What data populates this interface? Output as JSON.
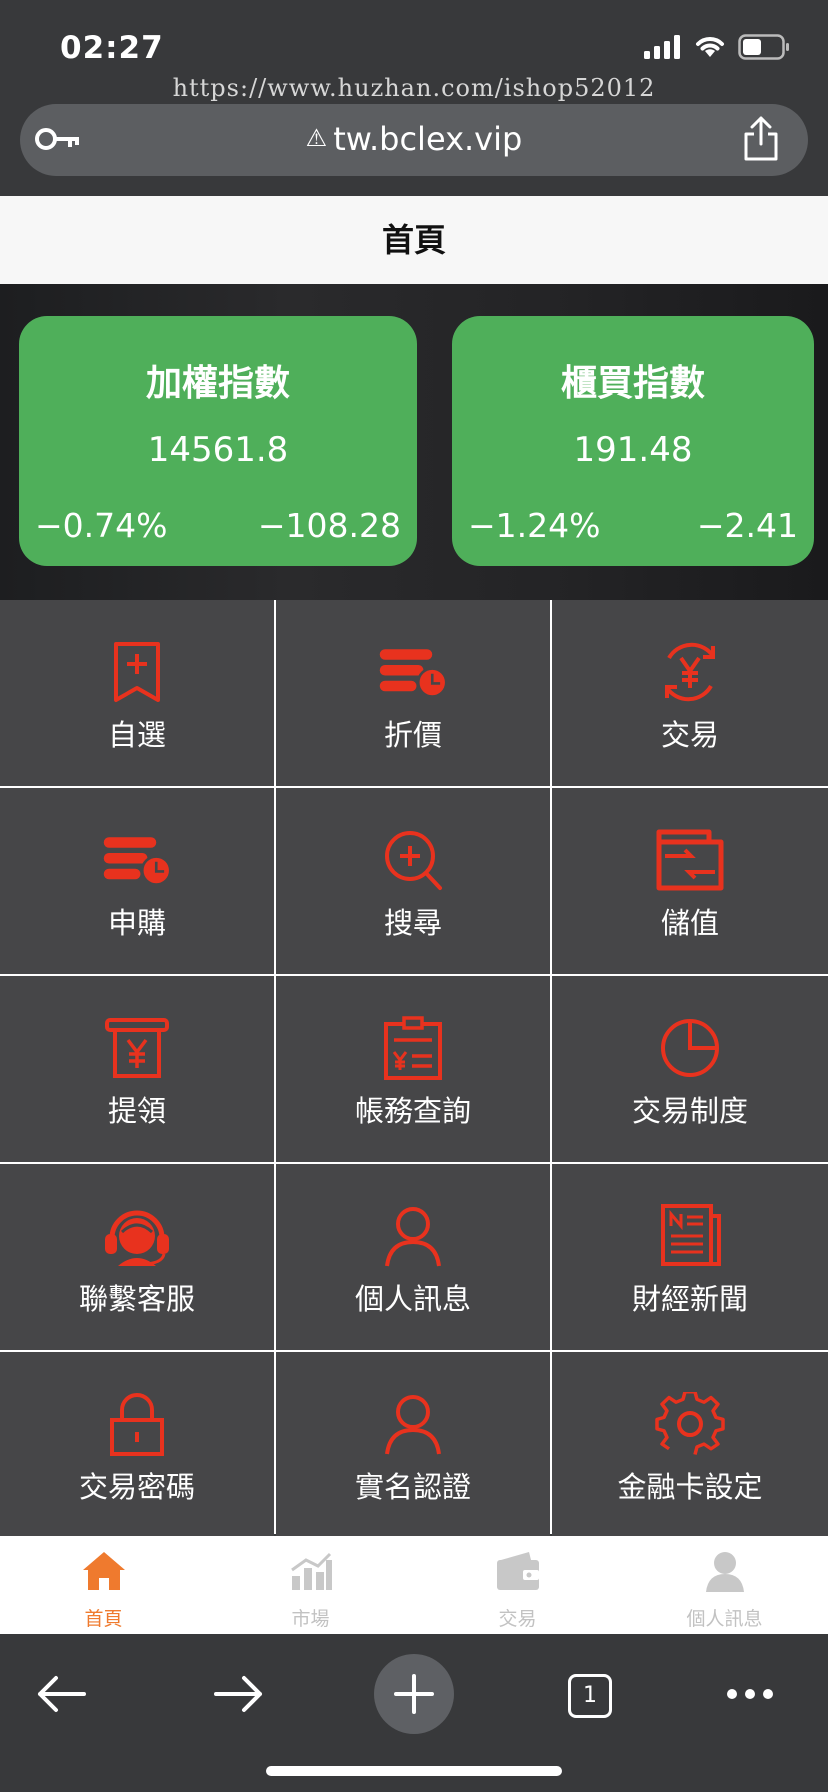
{
  "status_bar": {
    "time": "02:27"
  },
  "browser": {
    "watermark": "https://www.huzhan.com/ishop52012",
    "url": "tw.bclex.vip",
    "warning_glyph": "⚠",
    "open_tabs": "1"
  },
  "header": {
    "title": "首頁"
  },
  "indices": [
    {
      "name": "加權指數",
      "value": "14561.8",
      "change_pct": "−0.74%",
      "change": "−108.28"
    },
    {
      "name": "櫃買指數",
      "value": "191.48",
      "change_pct": "−1.24%",
      "change": "−2.41"
    }
  ],
  "grid": {
    "items": [
      {
        "label": "自選",
        "icon": "bookmark-plus-icon"
      },
      {
        "label": "折價",
        "icon": "discount-clock-icon"
      },
      {
        "label": "交易",
        "icon": "yen-cycle-icon"
      },
      {
        "label": "申購",
        "icon": "subscribe-clock-icon"
      },
      {
        "label": "搜尋",
        "icon": "search-plus-icon"
      },
      {
        "label": "儲值",
        "icon": "wallet-transfer-icon"
      },
      {
        "label": "提領",
        "icon": "atm-withdraw-icon"
      },
      {
        "label": "帳務查詢",
        "icon": "clipboard-ledger-icon"
      },
      {
        "label": "交易制度",
        "icon": "pie-chart-icon"
      },
      {
        "label": "聯繫客服",
        "icon": "customer-service-icon"
      },
      {
        "label": "個人訊息",
        "icon": "user-icon"
      },
      {
        "label": "財經新聞",
        "icon": "newspaper-icon"
      },
      {
        "label": "交易密碼",
        "icon": "lock-icon"
      },
      {
        "label": "實名認證",
        "icon": "user-verify-icon"
      },
      {
        "label": "金融卡設定",
        "icon": "gear-icon"
      }
    ]
  },
  "tabbar": {
    "items": [
      {
        "label": "首頁",
        "icon": "home-icon",
        "active": true
      },
      {
        "label": "市場",
        "icon": "bar-chart-icon",
        "active": false
      },
      {
        "label": "交易",
        "icon": "wallet-icon",
        "active": false
      },
      {
        "label": "個人訊息",
        "icon": "person-icon",
        "active": false
      }
    ]
  },
  "colors": {
    "accent_red": "#e8321e",
    "index_green": "#4faf5a",
    "tab_active": "#ef7a2e",
    "tab_inactive": "#c8c8c8",
    "grid_bg": "#464648"
  }
}
